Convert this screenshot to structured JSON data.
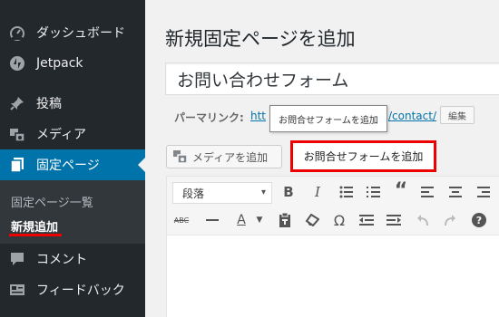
{
  "sidebar": {
    "items": [
      {
        "label": "ダッシュボード",
        "icon": "dashboard-icon"
      },
      {
        "label": "Jetpack",
        "icon": "jetpack-icon"
      },
      {
        "label": "投稿",
        "icon": "pin-icon"
      },
      {
        "label": "メディア",
        "icon": "media-icon"
      },
      {
        "label": "固定ページ",
        "icon": "pages-icon"
      },
      {
        "label": "コメント",
        "icon": "comment-icon"
      },
      {
        "label": "フィードバック",
        "icon": "feedback-icon"
      }
    ],
    "submenu": [
      {
        "label": "固定ページ一覧"
      },
      {
        "label": "新規追加"
      }
    ],
    "colors": {
      "background": "#23282d",
      "current": "#0073aa"
    }
  },
  "main": {
    "title": "新規固定ページを追加",
    "page_title_value": "お問い合わせフォーム",
    "permalink": {
      "label": "パーマリンク:",
      "url_start": "htt",
      "url_end": "/contact/",
      "edit_label": "編集"
    },
    "tooltip": "お問合せフォームを追加",
    "media_button": "メディアを追加",
    "form_button": "お問合せフォームを追加",
    "editor": {
      "format_select": "段落",
      "toolbar_row1": [
        "bold-icon",
        "italic-icon",
        "bullet-list-icon",
        "numbered-list-icon",
        "blockquote-icon",
        "align-left-icon",
        "align-center-icon",
        "align-right-icon"
      ],
      "toolbar_row2": [
        "strikethrough-icon",
        "horizontal-rule-icon",
        "text-color-icon",
        "paste-as-text-icon",
        "clear-formatting-icon",
        "special-character-icon",
        "outdent-icon",
        "indent-icon",
        "undo-icon",
        "redo-icon",
        "help-icon"
      ]
    },
    "highlight_color": "#e00000"
  }
}
